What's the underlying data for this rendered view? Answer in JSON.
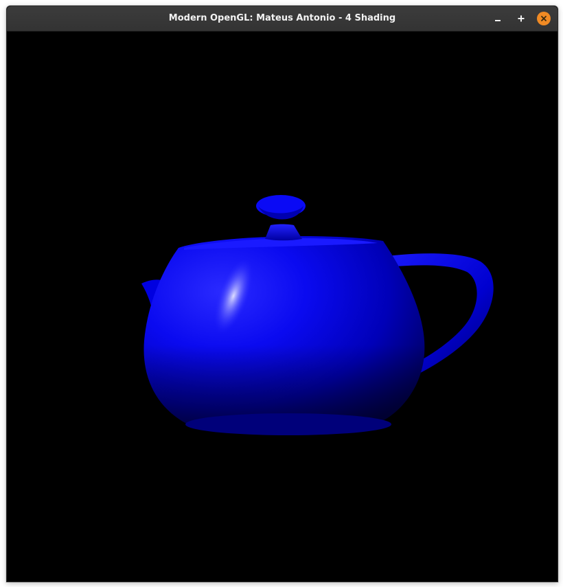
{
  "window": {
    "title": "Modern OpenGL: Mateus Antonio - 4 Shading"
  },
  "controls": {
    "minimize_icon": "minimize-icon",
    "maximize_icon": "maximize-icon",
    "close_icon": "close-icon",
    "close_color": "#f08a24"
  },
  "scene": {
    "background_color": "#000000",
    "object": "teapot",
    "object_color": "#0000ff"
  }
}
